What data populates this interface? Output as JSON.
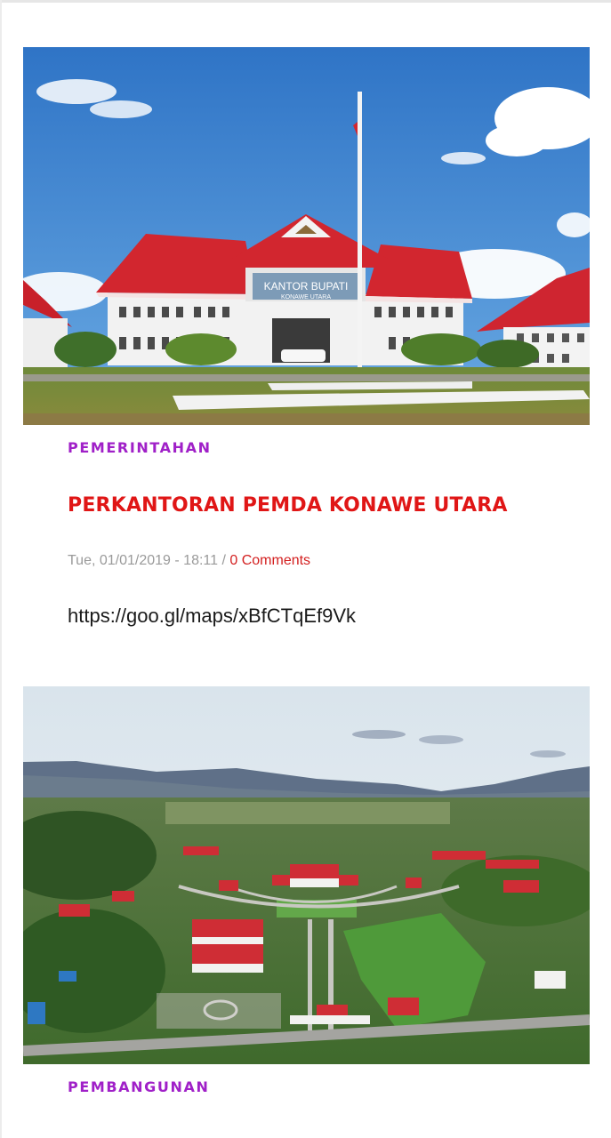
{
  "posts": [
    {
      "image_alt": "Kantor Bupati Konawe Utara",
      "sign_text": "KANTOR BUPATI",
      "sign_subtext": "KONAWE UTARA",
      "category": "PEMERINTAHAN",
      "title": "PERKANTORAN PEMDA KONAWE UTARA",
      "date": "Tue, 01/01/2019 - 18:11",
      "separator": " / ",
      "comments": "0 Comments",
      "excerpt": "https://goo.gl/maps/xBfCTqEf9Vk"
    },
    {
      "image_alt": "Aerial view of Konawe Utara government complex",
      "category": "PEMBANGUNAN"
    }
  ],
  "colors": {
    "category": "#a020c8",
    "title": "#e01616",
    "comments": "#d31f1f",
    "meta": "#9a9a9a",
    "roof": "#d2262f",
    "sky": "#3f86d0"
  }
}
